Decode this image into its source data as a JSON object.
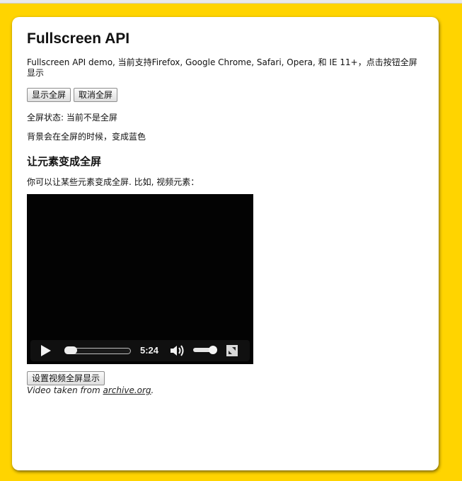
{
  "page": {
    "title": "Fullscreen API",
    "intro": "Fullscreen API demo, 当前支持Firefox, Google Chrome, Safari, Opera, 和 IE 11+，点击按钮全屏显示",
    "buttons": {
      "show_fullscreen": "显示全屏",
      "cancel_fullscreen": "取消全屏"
    },
    "status_text": "全屏状态: 当前不是全屏",
    "bg_note": "背景会在全屏的时候，变成蓝色",
    "section_title": "让元素变成全屏",
    "section_desc": "你可以让某些元素变成全屏. 比如, 视频元素：",
    "video": {
      "duration_label": "5:24",
      "progress_fraction": 0.0,
      "volume_fraction": 1.0,
      "icons": [
        "play-icon",
        "volume-icon",
        "fullscreen-icon"
      ]
    },
    "video_fullscreen_button": "设置视频全屏显示",
    "credit": {
      "prefix": "Video taken from ",
      "link": "archive.org",
      "suffix": "."
    }
  },
  "colors": {
    "background": "#ffd400",
    "panel": "#ffffff",
    "video": "#030303"
  }
}
